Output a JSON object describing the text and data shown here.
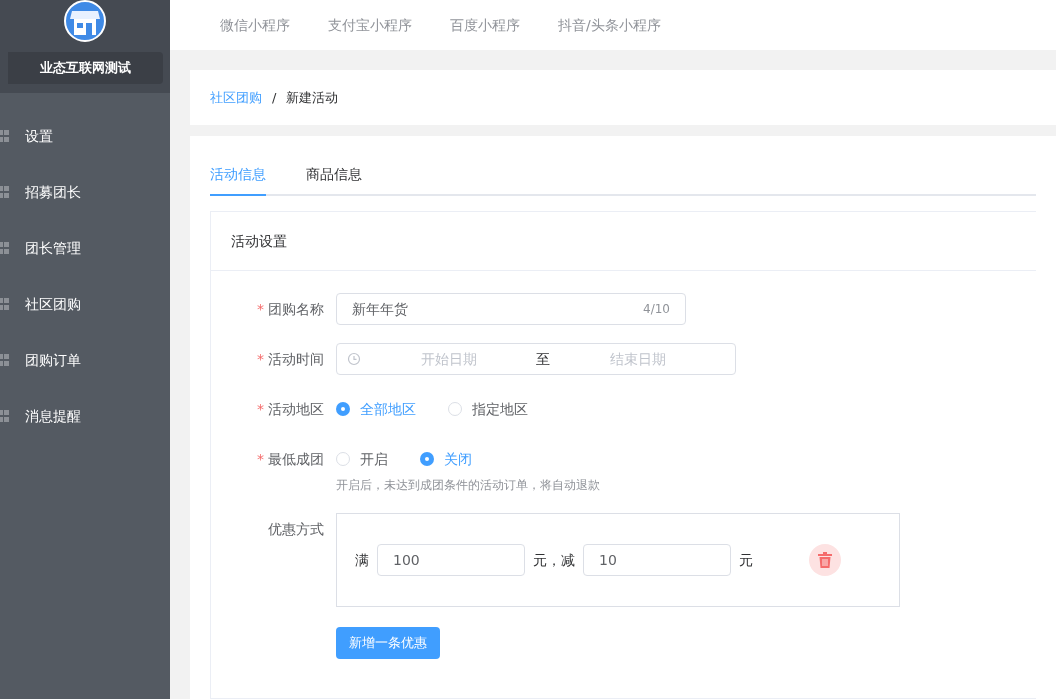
{
  "sidebar": {
    "store_name": "业态互联网测试",
    "items": [
      {
        "label": "设置"
      },
      {
        "label": "招募团长"
      },
      {
        "label": "团长管理"
      },
      {
        "label": "社区团购"
      },
      {
        "label": "团购订单"
      },
      {
        "label": "消息提醒"
      }
    ]
  },
  "top_nav": [
    {
      "label": "微信小程序"
    },
    {
      "label": "支付宝小程序"
    },
    {
      "label": "百度小程序"
    },
    {
      "label": "抖音/头条小程序"
    }
  ],
  "breadcrumb": [
    {
      "label": "社区团购",
      "kind": "link"
    },
    {
      "label": "新建活动",
      "kind": "current"
    }
  ],
  "breadcrumb_separator": "/",
  "tabs": [
    {
      "label": "活动信息",
      "selected": true
    },
    {
      "label": "商品信息",
      "selected": false
    }
  ],
  "panel_title": "活动设置",
  "fields": [
    {
      "kind": "text",
      "required_mark": "*",
      "label": "团购名称",
      "value": "新年年货",
      "counter": "4/10"
    },
    {
      "kind": "daterange",
      "required_mark": "*",
      "label": "活动时间",
      "start_placeholder": "开始日期",
      "separator": "至",
      "end_placeholder": "结束日期"
    },
    {
      "kind": "radio",
      "required_mark": "*",
      "label": "活动地区",
      "options": [
        {
          "label": "全部地区",
          "selected": true
        },
        {
          "label": "指定地区",
          "selected": false
        }
      ]
    },
    {
      "kind": "radio",
      "required_mark": "*",
      "label": "最低成团",
      "options": [
        {
          "label": "开启",
          "selected": false
        },
        {
          "label": "关闭",
          "selected": true
        }
      ],
      "hint": "开启后，未达到成团条件的活动订单，将自动退款"
    },
    {
      "kind": "discount",
      "label": "优惠方式",
      "rules": [
        {
          "prefix": "满",
          "threshold": "100",
          "middle": "元，减",
          "amount": "10",
          "suffix": "元"
        }
      ],
      "add_button": "新增一条优惠"
    }
  ]
}
